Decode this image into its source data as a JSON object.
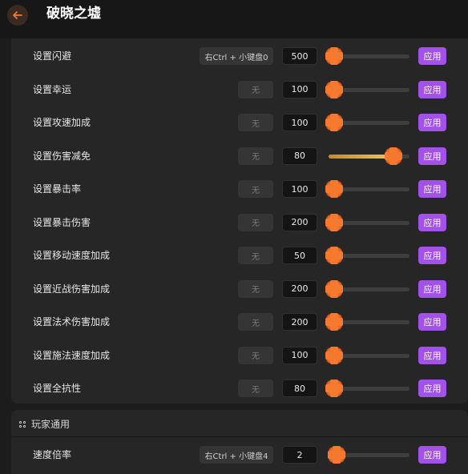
{
  "header": {
    "title": "破晓之墟",
    "back_icon": "arrow-left-icon"
  },
  "settings": [
    {
      "label": "设置闪避",
      "hotkey": "右Ctrl + 小键盘0",
      "value": "500",
      "level": 0.0,
      "apply": "应用"
    },
    {
      "label": "设置幸运",
      "hotkey": "无",
      "value": "100",
      "level": 0.0,
      "apply": "应用"
    },
    {
      "label": "设置攻速加成",
      "hotkey": "无",
      "value": "100",
      "level": 0.0,
      "apply": "应用"
    },
    {
      "label": "设置伤害减免",
      "hotkey": "无",
      "value": "80",
      "level": 0.8,
      "apply": "应用"
    },
    {
      "label": "设置暴击率",
      "hotkey": "无",
      "value": "100",
      "level": 0.0,
      "apply": "应用"
    },
    {
      "label": "设置暴击伤害",
      "hotkey": "无",
      "value": "200",
      "level": 0.0,
      "apply": "应用"
    },
    {
      "label": "设置移动速度加成",
      "hotkey": "无",
      "value": "50",
      "level": 0.0,
      "apply": "应用"
    },
    {
      "label": "设置近战伤害加成",
      "hotkey": "无",
      "value": "200",
      "level": 0.0,
      "apply": "应用"
    },
    {
      "label": "设置法术伤害加成",
      "hotkey": "无",
      "value": "200",
      "level": 0.0,
      "apply": "应用"
    },
    {
      "label": "设置施法速度加成",
      "hotkey": "无",
      "value": "100",
      "level": 0.0,
      "apply": "应用"
    },
    {
      "label": "设置全抗性",
      "hotkey": "无",
      "value": "80",
      "level": 0.0,
      "apply": "应用"
    }
  ],
  "player_section": {
    "title": "玩家通用",
    "icon": "grid-icon",
    "items": [
      {
        "label": "速度倍率",
        "hotkey": "右Ctrl + 小键盘4",
        "value": "2",
        "level": 0.1,
        "apply": "应用"
      }
    ]
  },
  "colors": {
    "accent": "#a252e8",
    "knob": "#f06a24",
    "fill": "#f4c45a"
  }
}
